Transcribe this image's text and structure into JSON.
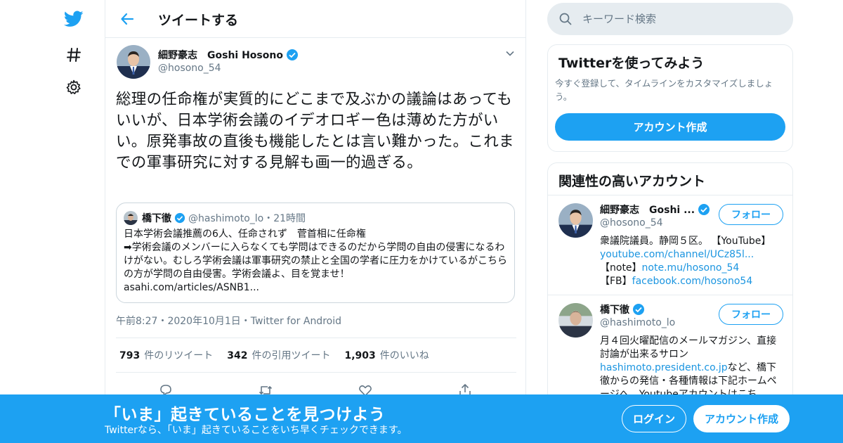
{
  "colors": {
    "accent": "#1da1f2",
    "text": "#14171a",
    "muted": "#657786",
    "border": "#e6ecf0",
    "link": "#1b95e0"
  },
  "nav": {
    "icons": [
      "twitter-logo-icon",
      "hashtag-icon",
      "gear-icon"
    ]
  },
  "header": {
    "title": "ツイートする",
    "back_icon": "arrow-left-icon"
  },
  "tweet": {
    "author_name": "細野豪志　Goshi Hosono",
    "author_handle": "@hosono_54",
    "text": "総理の任命権が実質的にどこまで及ぶかの議論はあってもいいが、日本学術会議のイデオロギー色は薄めた方がいい。原発事故の直後も機能したとは言い難かった。これまでの軍事研究に対する見解も画一的過ぎる。",
    "timestamp": "午前8:27・2020年10月1日・Twitter for Android",
    "stats": [
      {
        "num": "793",
        "label": "件のリツイート"
      },
      {
        "num": "342",
        "label": "件の引用ツイート"
      },
      {
        "num": "1,903",
        "label": "件のいいね"
      }
    ],
    "actions": [
      "reply-icon",
      "retweet-icon",
      "like-icon",
      "share-icon"
    ]
  },
  "quote": {
    "name": "橋下徹",
    "meta": "@hashimoto_lo・21時間",
    "text": "日本学術会議推薦の6人、任命されず　菅首相に任命権\n➡学術会議のメンバーに入らなくても学問はできるのだから学問の自由の侵害になるわけがない。むしろ学術会議は軍事研究の禁止と全国の学者に圧力をかけているがこちらの方が学問の自由侵害。学術会議よ、目を覚ませ！\nasahi.com/articles/ASNB1..."
  },
  "search": {
    "placeholder": "キーワード検索"
  },
  "signup_card": {
    "title": "Twitterを使ってみよう",
    "desc": "今すぐ登録して、タイムラインをカスタマイズしましょう。",
    "button": "アカウント作成"
  },
  "related": {
    "title": "関連性の高いアカウント",
    "follow_label": "フォロー",
    "users": [
      {
        "name": "細野豪志　Goshi ...",
        "handle": "@hosono_54",
        "bio_1": "衆議院議員。静岡５区。 【YouTube】",
        "link_1": "youtube.com/channel/UCz85l...",
        "bio_2_pre": "【note】",
        "link_2": "note.mu/hosono_54",
        "bio_3_pre": "【FB】",
        "link_3": "facebook.com/hosono54"
      },
      {
        "name": "橋下徹",
        "handle": "@hashimoto_lo",
        "bio_1": "月４回火曜配信のメールマガジン、直接討論が出来るサロン",
        "link_1": "hashimoto.president.co.jp",
        "bio_2": "など、橋下徹からの発信・各種情報は下記ホームページへ。Youtubeアカウントはこち"
      }
    ]
  },
  "banner": {
    "title": "「いま」起きていることを見つけよう",
    "subtitle": "Twitterなら、「いま」起きていることをいち早くチェックできます。",
    "login": "ログイン",
    "signup": "アカウント作成"
  }
}
